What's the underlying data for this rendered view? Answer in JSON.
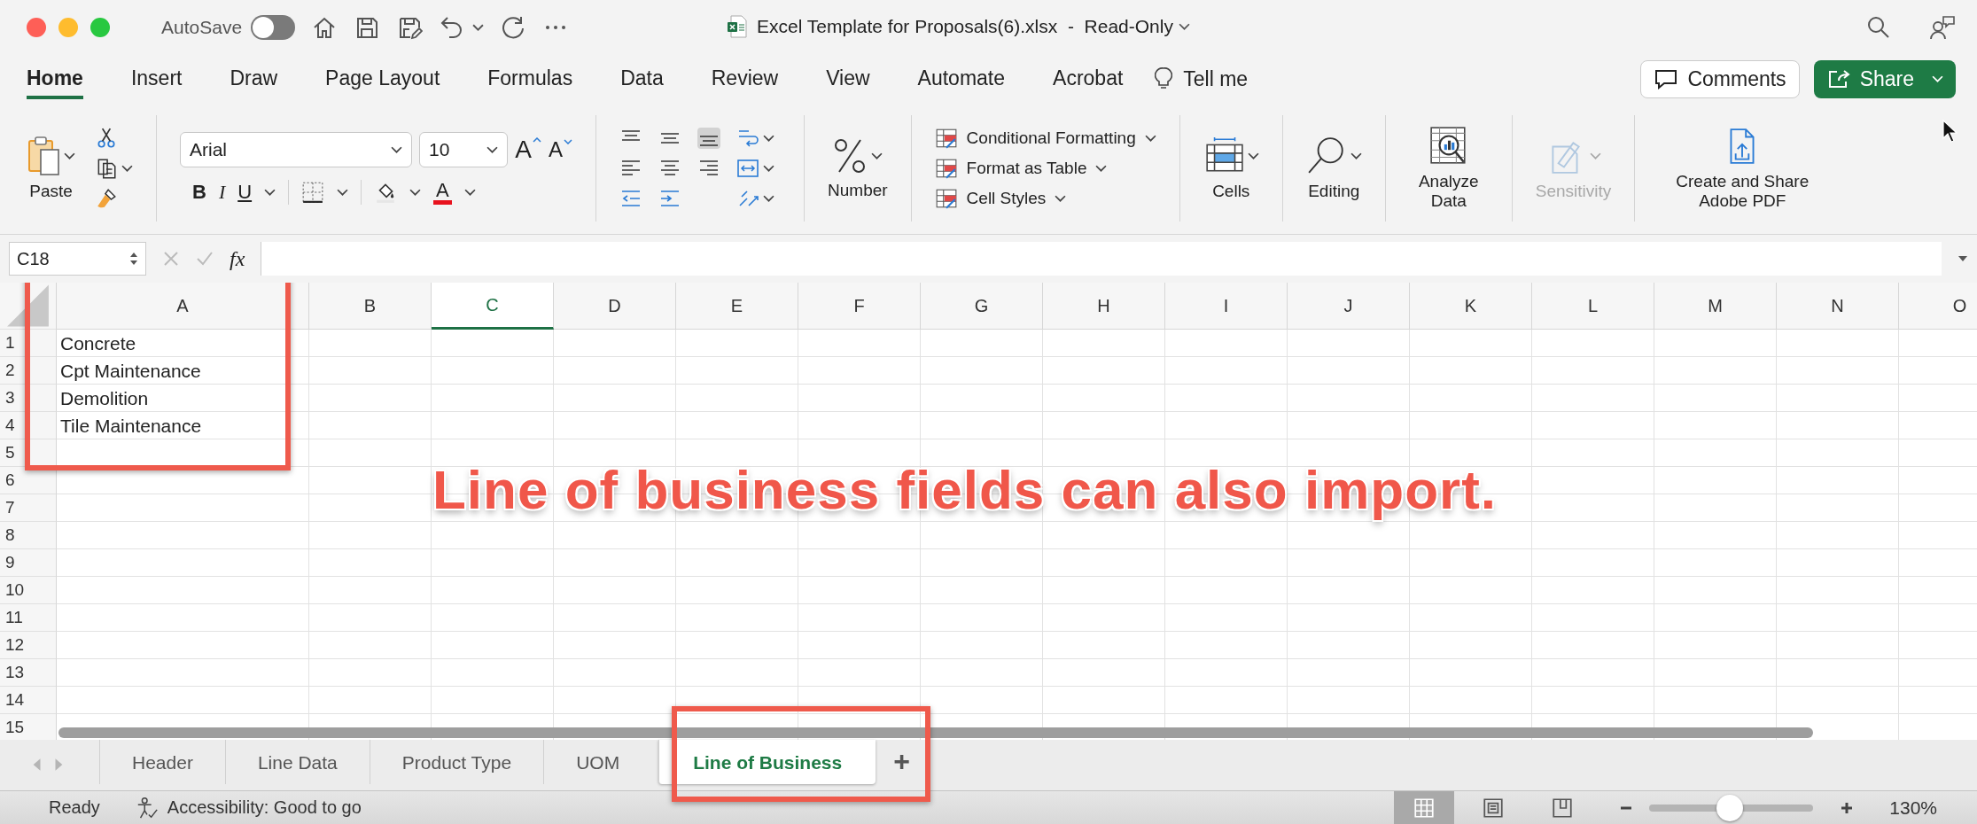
{
  "window": {
    "autosave_label": "AutoSave",
    "autosave_on": false,
    "title": "Excel Template for Proposals(6).xlsx  -  Read-Only"
  },
  "ribbon_tabs": [
    {
      "label": "Home",
      "selected": true
    },
    {
      "label": "Insert",
      "selected": false
    },
    {
      "label": "Draw",
      "selected": false
    },
    {
      "label": "Page Layout",
      "selected": false
    },
    {
      "label": "Formulas",
      "selected": false
    },
    {
      "label": "Data",
      "selected": false
    },
    {
      "label": "Review",
      "selected": false
    },
    {
      "label": "View",
      "selected": false
    },
    {
      "label": "Automate",
      "selected": false
    },
    {
      "label": "Acrobat",
      "selected": false
    }
  ],
  "tell_me": "Tell me",
  "comments_button": "Comments",
  "share_button": "Share",
  "ribbon": {
    "paste": "Paste",
    "font_name": "Arial",
    "font_size": "10",
    "grow_font": "A",
    "shrink_font": "A",
    "bold": "B",
    "italic": "I",
    "underline": "U",
    "font_color": "A",
    "number": "Number",
    "styles": [
      "Conditional Formatting",
      "Format as Table",
      "Cell Styles"
    ],
    "cells": "Cells",
    "editing": "Editing",
    "analyze": "Analyze Data",
    "sensitivity": {
      "label": "Sensitivity",
      "disabled": true
    },
    "pdf": "Create and Share Adobe PDF"
  },
  "formula_bar": {
    "name_box": "C18",
    "fx": "fx"
  },
  "sheet": {
    "columns": [
      {
        "label": "A",
        "selected": false
      },
      {
        "label": "B",
        "selected": false
      },
      {
        "label": "C",
        "selected": true
      },
      {
        "label": "D",
        "selected": false
      },
      {
        "label": "E",
        "selected": false
      },
      {
        "label": "F",
        "selected": false
      },
      {
        "label": "G",
        "selected": false
      },
      {
        "label": "H",
        "selected": false
      },
      {
        "label": "I",
        "selected": false
      },
      {
        "label": "J",
        "selected": false
      },
      {
        "label": "K",
        "selected": false
      },
      {
        "label": "L",
        "selected": false
      },
      {
        "label": "M",
        "selected": false
      },
      {
        "label": "N",
        "selected": false
      },
      {
        "label": "O",
        "selected": false
      }
    ],
    "rows": [
      {
        "number": "1",
        "cells": [
          "Concrete"
        ]
      },
      {
        "number": "2",
        "cells": [
          "Cpt Maintenance"
        ]
      },
      {
        "number": "3",
        "cells": [
          "Demolition"
        ]
      },
      {
        "number": "4",
        "cells": [
          "Tile Maintenance"
        ]
      },
      {
        "number": "5"
      },
      {
        "number": "6"
      },
      {
        "number": "7"
      },
      {
        "number": "8"
      },
      {
        "number": "9"
      },
      {
        "number": "10"
      },
      {
        "number": "11"
      },
      {
        "number": "12"
      },
      {
        "number": "13"
      },
      {
        "number": "14"
      },
      {
        "number": "15"
      }
    ]
  },
  "annotation": "Line of business fields can also import.",
  "sheet_tabs": [
    {
      "label": "Header",
      "selected": false
    },
    {
      "label": "Line Data",
      "selected": false
    },
    {
      "label": "Product Type",
      "selected": false
    },
    {
      "label": "UOM",
      "selected": false
    },
    {
      "label": "Line of Business",
      "selected": true
    }
  ],
  "add_sheet": "+",
  "status_bar": {
    "status": "Ready",
    "accessibility": "Accessibility: Good to go",
    "views": [
      {
        "kind": "normal",
        "selected": true
      },
      {
        "kind": "page_layout",
        "selected": false
      },
      {
        "kind": "page_break",
        "selected": false
      }
    ],
    "zoom": {
      "level": 0.49,
      "label": "130%"
    }
  }
}
